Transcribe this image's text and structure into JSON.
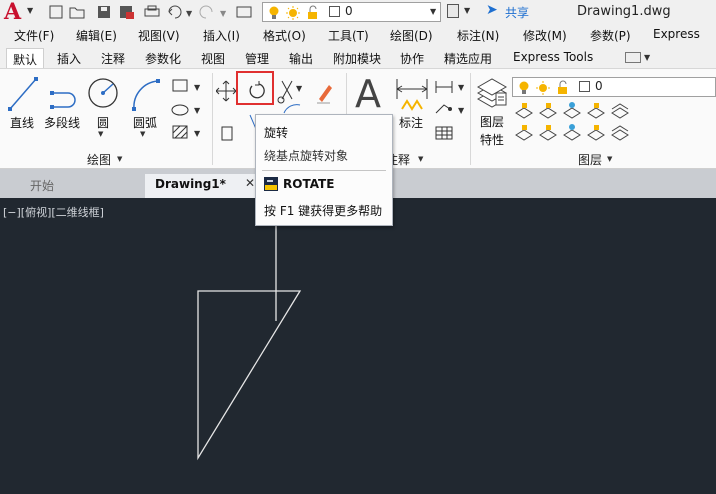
{
  "app": {
    "title": "Drawing1.dwg",
    "share_label": "共享",
    "layer_value": "0",
    "logo_letter": "A"
  },
  "menubar": {
    "items": [
      "文件(F)",
      "编辑(E)",
      "视图(V)",
      "插入(I)",
      "格式(O)",
      "工具(T)",
      "绘图(D)",
      "标注(N)",
      "修改(M)",
      "参数(P)",
      "Express"
    ]
  },
  "ribbon_tabs": {
    "items": [
      "默认",
      "插入",
      "注释",
      "参数化",
      "视图",
      "管理",
      "输出",
      "附加模块",
      "协作",
      "精选应用",
      "Express Tools"
    ],
    "active_index": 0
  },
  "ribbon": {
    "line_label": "直线",
    "polyline_label": "多段线",
    "circle_label": "圆",
    "arc_label": "圆弧",
    "draw_panel_label": "绘图",
    "annotation_panel_label": "注释",
    "dimension_label": "标注",
    "layer_properties_label": "图层\n特性",
    "layer_properties_line1": "图层",
    "layer_properties_line2": "特性",
    "layers_panel_label": "图层",
    "layer_dropdown_value": "0"
  },
  "tooltip": {
    "title": "旋转",
    "description": "绕基点旋转对象",
    "command": "ROTATE",
    "help": "按 F1 键获得更多帮助"
  },
  "doc_tabs": {
    "items": [
      "开始",
      "Drawing1*"
    ],
    "active_index": 1
  },
  "viewport": {
    "label": "[−][俯视][二维线框]"
  },
  "colors": {
    "canvas": "#212830",
    "highlight": "#e03030",
    "accent": "#1e6fd0"
  }
}
